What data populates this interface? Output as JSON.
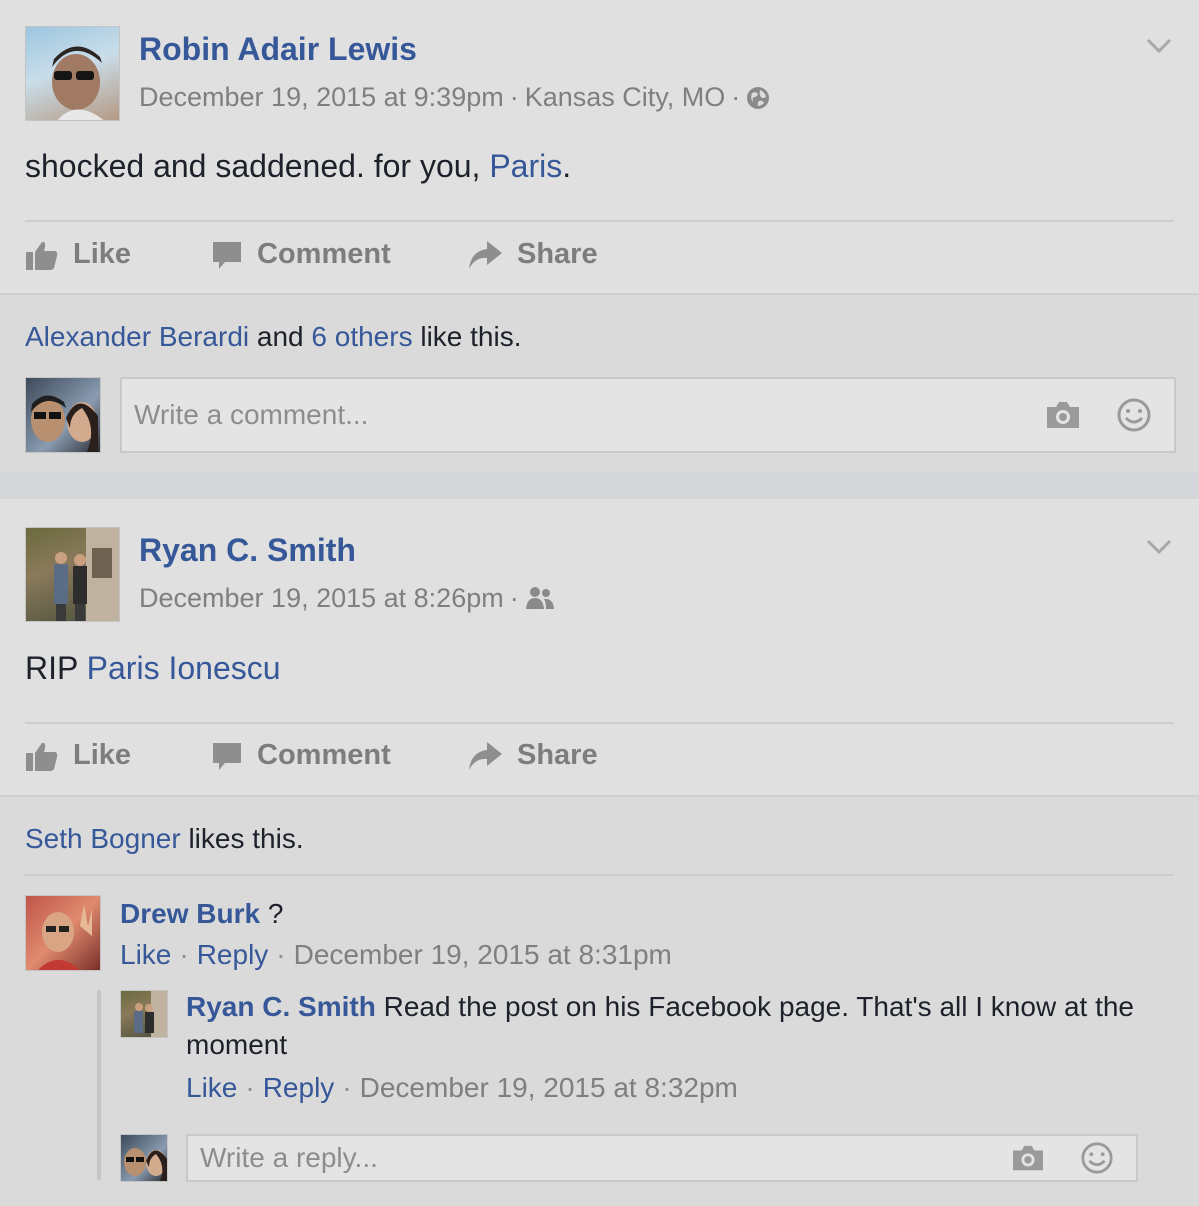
{
  "posts": [
    {
      "author": "Robin Adair Lewis",
      "date": "December 19, 2015 at 9:39pm",
      "location": "Kansas City, MO",
      "privacy_icon": "globe-icon",
      "text_before": "shocked and saddened. for you, ",
      "text_link": "Paris",
      "text_after": ".",
      "actions": {
        "like": "Like",
        "comment": "Comment",
        "share": "Share"
      },
      "likes_name": "Alexander Berardi",
      "likes_and": " and ",
      "likes_others": "6 others",
      "likes_suffix": " like this.",
      "comment_placeholder": "Write a comment..."
    },
    {
      "author": "Ryan C. Smith",
      "date": "December 19, 2015 at 8:26pm",
      "privacy_icon": "friends-icon",
      "text_before": "RIP ",
      "text_link": "Paris Ionescu",
      "actions": {
        "like": "Like",
        "comment": "Comment",
        "share": "Share"
      },
      "likes_name": "Seth Bogner",
      "likes_suffix": " likes this.",
      "comments": [
        {
          "author": "Drew Burk",
          "text": " ?",
          "like": "Like",
          "reply": "Reply",
          "date": "December 19, 2015 at 8:31pm"
        }
      ],
      "reply": {
        "author": "Ryan C. Smith",
        "text": " Read the post on his Facebook page. That's all I know at the moment",
        "like": "Like",
        "reply": "Reply",
        "date": "December 19, 2015 at 8:32pm"
      },
      "reply_placeholder": "Write a reply..."
    }
  ],
  "colors": {
    "link": "#365899",
    "meta": "#7f7f7f",
    "background": "#e0e0e0"
  }
}
